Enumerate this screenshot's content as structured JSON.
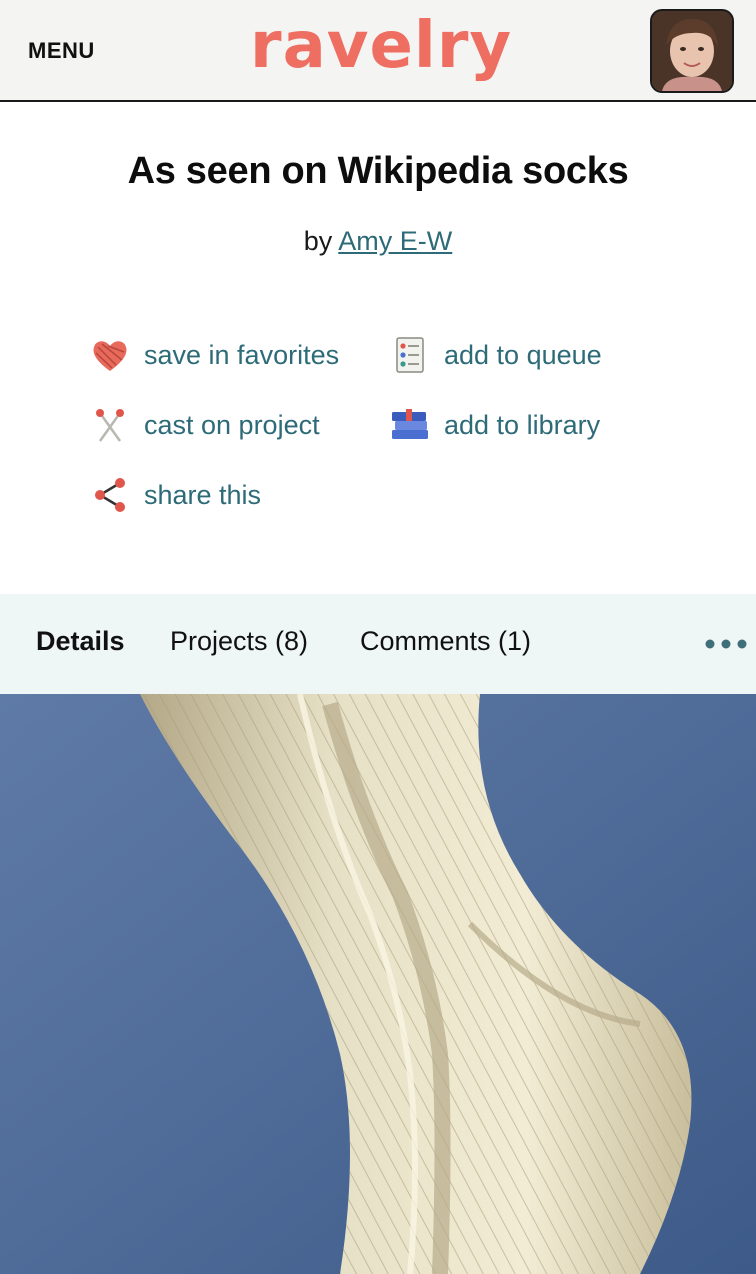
{
  "header": {
    "menu_label": "MENU",
    "logo_text": "ravelry"
  },
  "pattern": {
    "title": "As seen on Wikipedia socks",
    "by_prefix": "by",
    "author": "Amy E-W"
  },
  "actions": {
    "save_favorites": "save in favorites",
    "add_queue": "add to queue",
    "cast_on": "cast on project",
    "add_library": "add to library",
    "share": "share this"
  },
  "tabs": {
    "details": "Details",
    "projects": "Projects (8)",
    "comments": "Comments (1)"
  },
  "icons": {
    "favorites": "yarn-heart-icon",
    "queue": "queue-list-icon",
    "cast_on": "knitting-needles-icon",
    "library": "books-icon",
    "share": "share-icon",
    "more": "more-dots-icon"
  },
  "colors": {
    "brand": "#ee6e62",
    "link": "#2e6b78",
    "tab_bar_bg": "#eef7f6"
  }
}
